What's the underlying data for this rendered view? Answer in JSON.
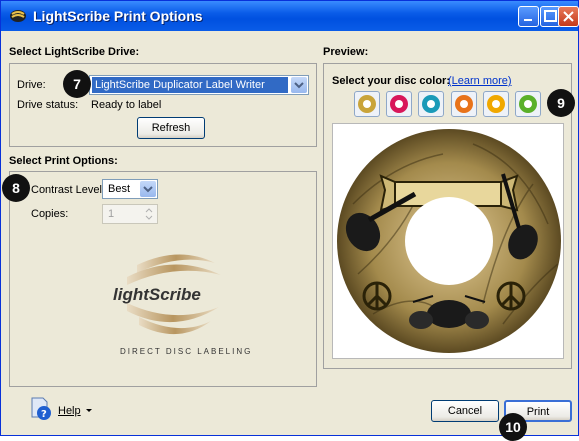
{
  "window": {
    "title": "LightScribe Print Options"
  },
  "drive_section": {
    "heading": "Select LightScribe Drive:",
    "drive_label": "Drive:",
    "drive_value": "LightScribe Duplicator Label Writer",
    "status_label": "Drive status:",
    "status_value": "Ready to label",
    "refresh_label": "Refresh"
  },
  "print_section": {
    "heading": "Select Print Options:",
    "contrast_label": "Contrast Level:",
    "contrast_value": "Best",
    "copies_label": "Copies:",
    "copies_value": "1",
    "logo_text": "lightScribe",
    "logo_tagline": "DIRECT DISC LABELING"
  },
  "preview": {
    "heading": "Preview:",
    "disc_color_label": "Select your disc color:",
    "learn_more": "(Learn more)",
    "disc_colors": [
      "#c9a43a",
      "#d8175a",
      "#1a9ab8",
      "#e8731a",
      "#f0a800",
      "#5ab02a"
    ]
  },
  "footer": {
    "help_label": "Help",
    "cancel_label": "Cancel",
    "print_label": "Print"
  },
  "badges": {
    "b7": "7",
    "b8": "8",
    "b9": "9",
    "b10": "10"
  }
}
